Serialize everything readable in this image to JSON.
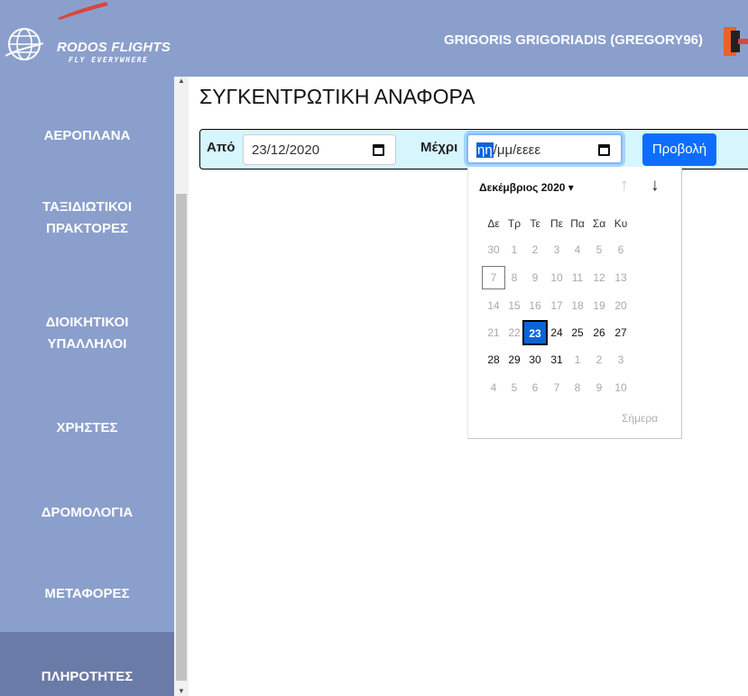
{
  "header": {
    "brand": "RODOS FLIGHTS",
    "tagline": "FLY EVERYWHERE",
    "user": "GRIGORIS GRIGORIADIS (GREGORY96)"
  },
  "sidebar": {
    "items": [
      {
        "label_1": "ΑΕΡΟΠΛΑΝΑ"
      },
      {
        "label_1": "ΤΑΞΙΔΙΩΤΙΚΟΙ",
        "label_2": "ΠΡΑΚΤΟΡΕΣ"
      },
      {
        "label_1": "ΔΙΟΙΚΗΤΙΚΟΙ",
        "label_2": "ΥΠΑΛΛΗΛΟΙ"
      },
      {
        "label_1": "ΧΡΗΣΤΕΣ"
      },
      {
        "label_1": "ΔΡΟΜΟΛΟΓΙΑ"
      },
      {
        "label_1": "ΜΕΤΑΦΟΡΕΣ"
      },
      {
        "label_1": "ΠΛΗΡΟΤΗΤΕΣ"
      }
    ]
  },
  "main": {
    "title": "ΣΥΓΚΕΝΤΡΩΤΙΚΗ ΑΝΑΦΟΡΑ",
    "from_label": "Από",
    "from_value": "23/12/2020",
    "to_label": "Μέχρι",
    "to_seg_day": "ηη",
    "to_seg_rest": "/μμ/εεεε",
    "view_button": "Προβολή"
  },
  "calendar": {
    "month_label": "Δεκέμβριος 2020 ▾",
    "weekdays": [
      "Δε",
      "Τρ",
      "Τε",
      "Πε",
      "Πα",
      "Σα",
      "Κυ"
    ],
    "weeks": [
      [
        "30",
        "1",
        "2",
        "3",
        "4",
        "5",
        "6"
      ],
      [
        "7",
        "8",
        "9",
        "10",
        "11",
        "12",
        "13"
      ],
      [
        "14",
        "15",
        "16",
        "17",
        "18",
        "19",
        "20"
      ],
      [
        "21",
        "22",
        "23",
        "24",
        "25",
        "26",
        "27"
      ],
      [
        "28",
        "29",
        "30",
        "31",
        "1",
        "2",
        "3"
      ],
      [
        "4",
        "5",
        "6",
        "7",
        "8",
        "9",
        "10"
      ]
    ],
    "today_label": "Σήμερα",
    "colors": {
      "accent": "#0a64d8",
      "sidebar": "#8b9fcc",
      "filter_bg": "#d6f6fd"
    }
  }
}
